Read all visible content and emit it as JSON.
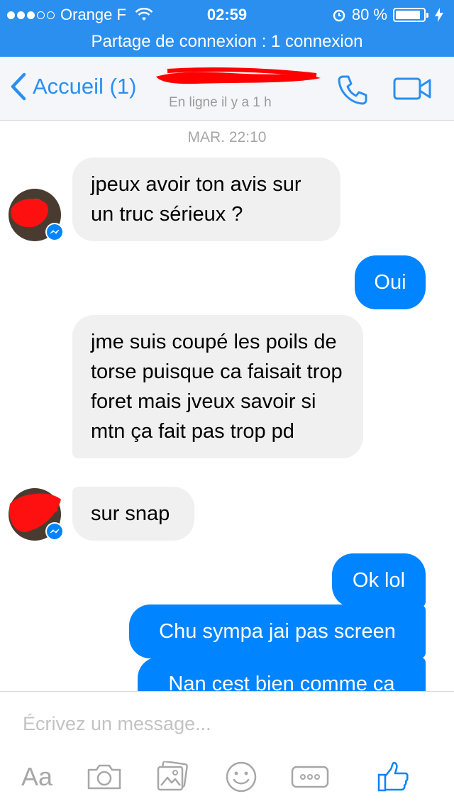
{
  "status_bar": {
    "carrier": "Orange F",
    "time": "02:59",
    "battery": "80 %",
    "battery_level": 0.8,
    "signal_bars_filled": 3
  },
  "hotspot": {
    "text": "Partage de connexion : 1 connexion"
  },
  "nav": {
    "back_label": "Accueil (1)",
    "contact_status": "En ligne il y a 1 h"
  },
  "chat": {
    "timestamp": "MAR. 22:10",
    "messages": [
      {
        "dir": "in",
        "text": "jpeux avoir ton avis sur un truc sérieux ?"
      },
      {
        "dir": "out",
        "text": "Oui"
      },
      {
        "dir": "in",
        "text": "jme suis coupé les poils de torse puisque ca faisait trop foret mais jveux savoir si mtn ça fait pas trop pd"
      },
      {
        "dir": "in",
        "text": "sur snap"
      },
      {
        "dir": "out",
        "text": "Ok lol"
      },
      {
        "dir": "out",
        "text": "Chu sympa jai pas screen"
      },
      {
        "dir": "out",
        "text": "Nan cest bien comme ca"
      }
    ]
  },
  "composer": {
    "placeholder": "Écrivez un message...",
    "aa_label": "Aa"
  },
  "icons": {
    "accent": "#0084ff",
    "bar": "#2b8ff0",
    "names": [
      "chevron-left-icon",
      "phone-icon",
      "video-icon",
      "camera-icon",
      "gallery-icon",
      "emoji-icon",
      "more-icon",
      "like-icon",
      "messenger-icon",
      "wifi-icon",
      "alarm-icon",
      "charging-icon"
    ]
  }
}
